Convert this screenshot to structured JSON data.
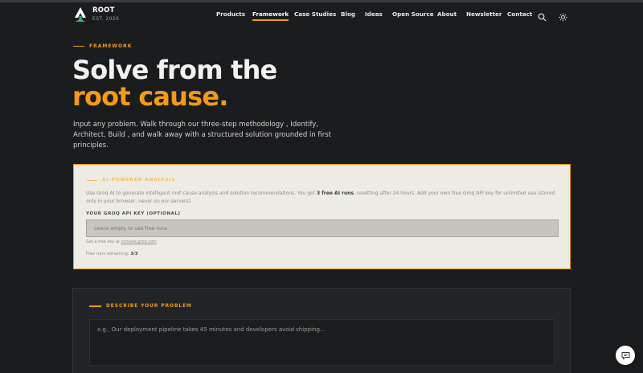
{
  "brand": {
    "name": "ROOT",
    "established": "EST. 2026"
  },
  "nav": {
    "items": [
      "Products",
      "Framework",
      "Case Studies",
      "Blog",
      "Ideas",
      "Open Source",
      "About",
      "Newsletter",
      "Contact"
    ],
    "active": "Framework",
    "icons": [
      "search-icon",
      "sun-icon"
    ]
  },
  "hero": {
    "eyebrow": "FRAMEWORK",
    "title_line1": "Solve from the",
    "title_line2": "root cause.",
    "description": "Input any problem. Walk through our three-step methodology , Identify, Architect, Build , and walk away with a structured solution grounded in first principles."
  },
  "ai_panel": {
    "eyebrow": "AI-POWERED ANALYSIS",
    "desc_before": "Use Groq AI to generate intelligent root cause analysis and solution recommendations. You get ",
    "desc_bold": "3 free AI runs",
    "desc_after": ", resetting after 24 hours. Add your own free Groq API key for unlimited use (stored only in your browser, never on our servers).",
    "key_label": "YOUR GROQ API KEY (OPTIONAL)",
    "key_placeholder": "Leave empty to use free runs",
    "hint_prefix": "Get a free key at ",
    "hint_link": "console.groq.com",
    "runs_label": "Free runs remaining: ",
    "runs_value": "3/3"
  },
  "problem": {
    "eyebrow": "DESCRIBE YOUR PROBLEM",
    "placeholder": "e.g., Our deployment pipeline takes 45 minutes and developers avoid shipping..."
  },
  "colors": {
    "accent": "#f29b18",
    "background": "#1b1c1e",
    "panel": "#ecebe4"
  },
  "chat": {
    "icon": "chat-icon"
  }
}
